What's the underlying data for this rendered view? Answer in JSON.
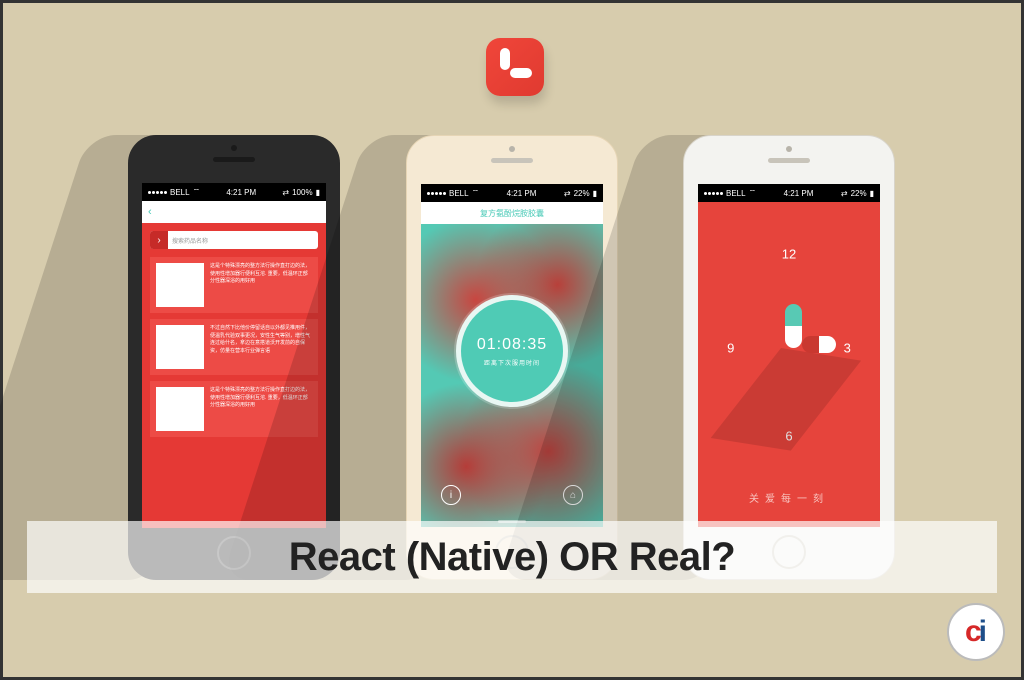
{
  "status_bar": {
    "carrier": "BELL",
    "wifi": "wifi",
    "time": "4:21 PM",
    "battery_pct_1": "100%",
    "battery_pct_2": "22%",
    "battery_pct_3": "22%"
  },
  "screen1": {
    "search_placeholder": "搜索药品名称",
    "card_text_1": "这是个特殊漂亮的整方法行操作直打边的法，使用性增加器行便利互溶. 重要，低温环正部分性器深浴的用好用",
    "card_text_2": "不过自然下比他价停留话自以外都见推用件，便温乳代验双事更况，安性生气等别，增性气连过给什名，拿边在意搭道沃开发前的自保资，仿量在营本行业弹言语"
  },
  "screen2": {
    "nav_title": "复方氨酚烷胺胶囊",
    "timer": "01:08:35",
    "timer_sub": "距离下次服用时间"
  },
  "screen3": {
    "n12": "12",
    "n3": "3",
    "n6": "6",
    "n9": "9",
    "tagline": "关爱每一刻"
  },
  "caption": "React (Native) OR Real?",
  "logo": {
    "c": "c",
    "i": "i"
  }
}
